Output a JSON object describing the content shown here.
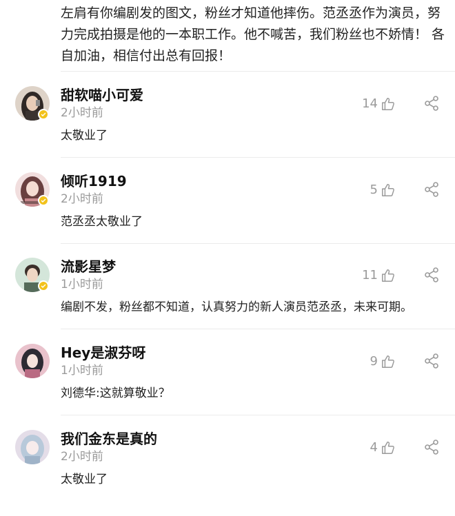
{
  "top_comment_text": "左肩有你编剧发的图文，粉丝才知道他摔伤。范丞丞作为演员，努力完成拍摄是他的一本职工作。他不喊苦，我们粉丝也不娇情！ 各自加油，相信付出总有回报！",
  "comments": [
    {
      "username": "甜软喵小可爱",
      "time": "2小时前",
      "text": "太敬业了",
      "likes": "14",
      "avatar_icon": "avatar-dark-hair-girl",
      "avatar_colors": [
        "#3a3330",
        "#d9c7b8"
      ]
    },
    {
      "username": "倾听1919",
      "time": "2小时前",
      "text": "范丞丞太敬业了",
      "likes": "5",
      "avatar_icon": "avatar-pink-girl",
      "avatar_colors": [
        "#5a3a3a",
        "#f0d5d0"
      ]
    },
    {
      "username": "流影星梦",
      "time": "1小时前",
      "text": "编剧不发，粉丝都不知道，认真努力的新人演员范丞丞，未来可期。",
      "likes": "11",
      "avatar_icon": "avatar-boy-green-bg",
      "avatar_colors": [
        "#3b2f2a",
        "#cfe3d6"
      ]
    },
    {
      "username": "Hey是淑芬呀",
      "time": "1小时前",
      "text": "刘德华:这就算敬业？",
      "likes": "9",
      "avatar_icon": "avatar-anime-girl-pink",
      "avatar_colors": [
        "#2d2a33",
        "#e8a9b8"
      ]
    },
    {
      "username": "我们金东是真的",
      "time": "2小时前",
      "text": "太敬业了",
      "likes": "4",
      "avatar_icon": "avatar-anime-pastel",
      "avatar_colors": [
        "#b8c9da",
        "#e9dfe8"
      ]
    }
  ],
  "colors": {
    "verified_badge": "#f2c21b",
    "secondary_text": "#9a9a9a",
    "divider": "#ebebeb"
  }
}
